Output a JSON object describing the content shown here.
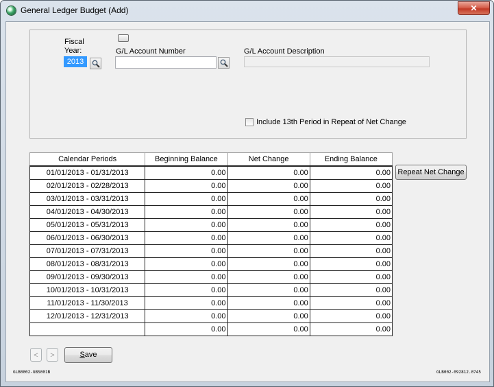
{
  "window": {
    "title": "General Ledger Budget (Add)",
    "close_glyph": "✕"
  },
  "form": {
    "fiscal_year_label_line1": "Fiscal",
    "fiscal_year_label_line2": "Year:",
    "fiscal_year_value": "2013",
    "account_number_label": "G/L Account Number",
    "account_number_value": "",
    "account_description_label": "G/L Account Description",
    "account_description_value": "",
    "include_13th_label": "Include 13th Period in Repeat of Net Change",
    "include_13th_checked": false
  },
  "grid": {
    "columns": [
      "Calendar Periods",
      "Beginning Balance",
      "Net Change",
      "Ending Balance"
    ],
    "rows": [
      {
        "period": "01/01/2013 - 01/31/2013",
        "beginning": "0.00",
        "net": "0.00",
        "ending": "0.00"
      },
      {
        "period": "02/01/2013 - 02/28/2013",
        "beginning": "0.00",
        "net": "0.00",
        "ending": "0.00"
      },
      {
        "period": "03/01/2013 - 03/31/2013",
        "beginning": "0.00",
        "net": "0.00",
        "ending": "0.00"
      },
      {
        "period": "04/01/2013 - 04/30/2013",
        "beginning": "0.00",
        "net": "0.00",
        "ending": "0.00"
      },
      {
        "period": "05/01/2013 - 05/31/2013",
        "beginning": "0.00",
        "net": "0.00",
        "ending": "0.00"
      },
      {
        "period": "06/01/2013 - 06/30/2013",
        "beginning": "0.00",
        "net": "0.00",
        "ending": "0.00"
      },
      {
        "period": "07/01/2013 - 07/31/2013",
        "beginning": "0.00",
        "net": "0.00",
        "ending": "0.00"
      },
      {
        "period": "08/01/2013 - 08/31/2013",
        "beginning": "0.00",
        "net": "0.00",
        "ending": "0.00"
      },
      {
        "period": "09/01/2013 - 09/30/2013",
        "beginning": "0.00",
        "net": "0.00",
        "ending": "0.00"
      },
      {
        "period": "10/01/2013 - 10/31/2013",
        "beginning": "0.00",
        "net": "0.00",
        "ending": "0.00"
      },
      {
        "period": "11/01/2013 - 11/30/2013",
        "beginning": "0.00",
        "net": "0.00",
        "ending": "0.00"
      },
      {
        "period": "12/01/2013 - 12/31/2013",
        "beginning": "0.00",
        "net": "0.00",
        "ending": "0.00"
      },
      {
        "period": "",
        "beginning": "0.00",
        "net": "0.00",
        "ending": "0.00"
      }
    ]
  },
  "buttons": {
    "repeat_net_change": "Repeat Net Change",
    "prev": "<",
    "next": ">",
    "save_first": "S",
    "save_rest": "ave"
  },
  "footer": {
    "left_code": "GLB0002-GBS001B",
    "right_code": "GLB002-092812.0745"
  },
  "colors": {
    "selection": "#3399ff",
    "close_button": "#c23a26",
    "window_frame": "#c7d2de"
  }
}
